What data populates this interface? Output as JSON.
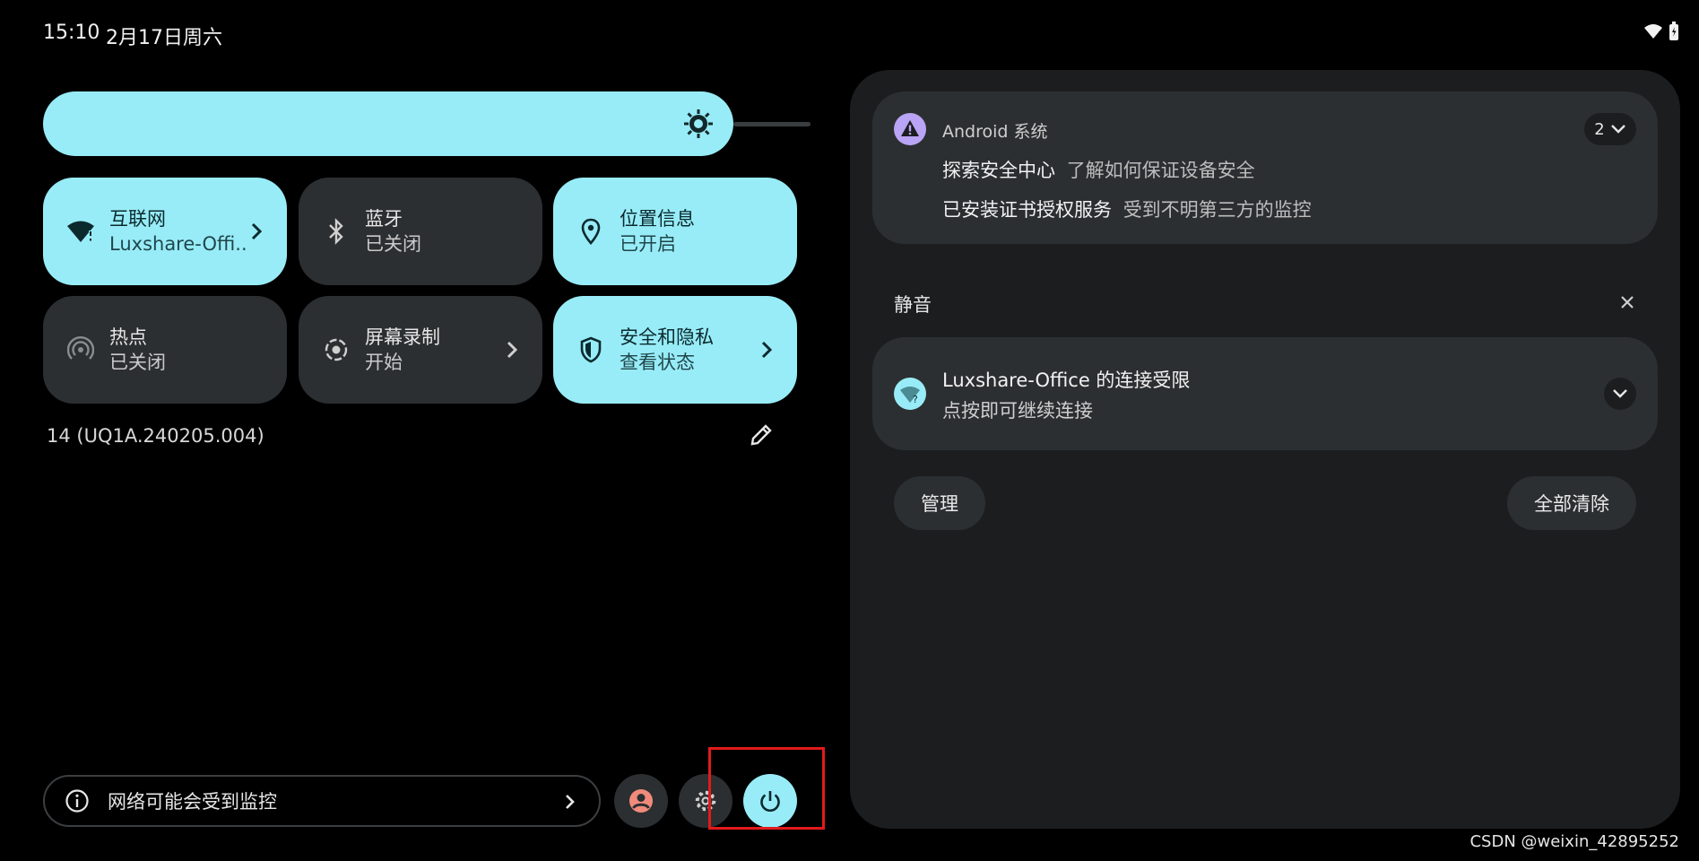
{
  "status_bar": {
    "time": "15:10",
    "date": "2月17日周六",
    "icons": [
      "wifi-alert-icon",
      "battery-icon"
    ]
  },
  "brightness": {
    "icon": "brightness-icon"
  },
  "tiles": [
    {
      "label": "互联网",
      "sub": "Luxshare-Offi..",
      "state": "on",
      "icon": "wifi-alert-icon",
      "chevron": true
    },
    {
      "label": "蓝牙",
      "sub": "已关闭",
      "state": "off",
      "icon": "bluetooth-icon",
      "chevron": false
    },
    {
      "label": "位置信息",
      "sub": "已开启",
      "state": "on",
      "icon": "location-icon",
      "chevron": false
    },
    {
      "label": "热点",
      "sub": "已关闭",
      "state": "off",
      "icon": "hotspot-icon",
      "chevron": false
    },
    {
      "label": "屏幕录制",
      "sub": "开始",
      "state": "off",
      "icon": "screen-record-icon",
      "chevron": true
    },
    {
      "label": "安全和隐私",
      "sub": "查看状态",
      "state": "on",
      "icon": "shield-icon",
      "chevron": true
    }
  ],
  "build_number": "14 (UQ1A.240205.004)",
  "footer": {
    "security_text": "网络可能会受到监控"
  },
  "notifications": {
    "system_app": "Android 系统",
    "system_count": "2",
    "lines": [
      {
        "title": "探索安全中心",
        "text": "了解如何保证设备安全"
      },
      {
        "title": "已安装证书授权服务",
        "text": "受到不明第三方的监控"
      }
    ],
    "silent_header": "静音",
    "wifi_title": "Luxshare-Office 的连接受限",
    "wifi_text": "点按即可继续连接",
    "manage_label": "管理",
    "clear_all_label": "全部清除"
  },
  "watermark": "CSDN @weixin_42895252",
  "colors": {
    "accent": "#98ecf7",
    "tile_off": "#2c2f31",
    "shade": "#1b1d1f",
    "highlight": "#e21a1a",
    "profile": "#f08b7c",
    "system_icon": "#b9a4f5"
  }
}
